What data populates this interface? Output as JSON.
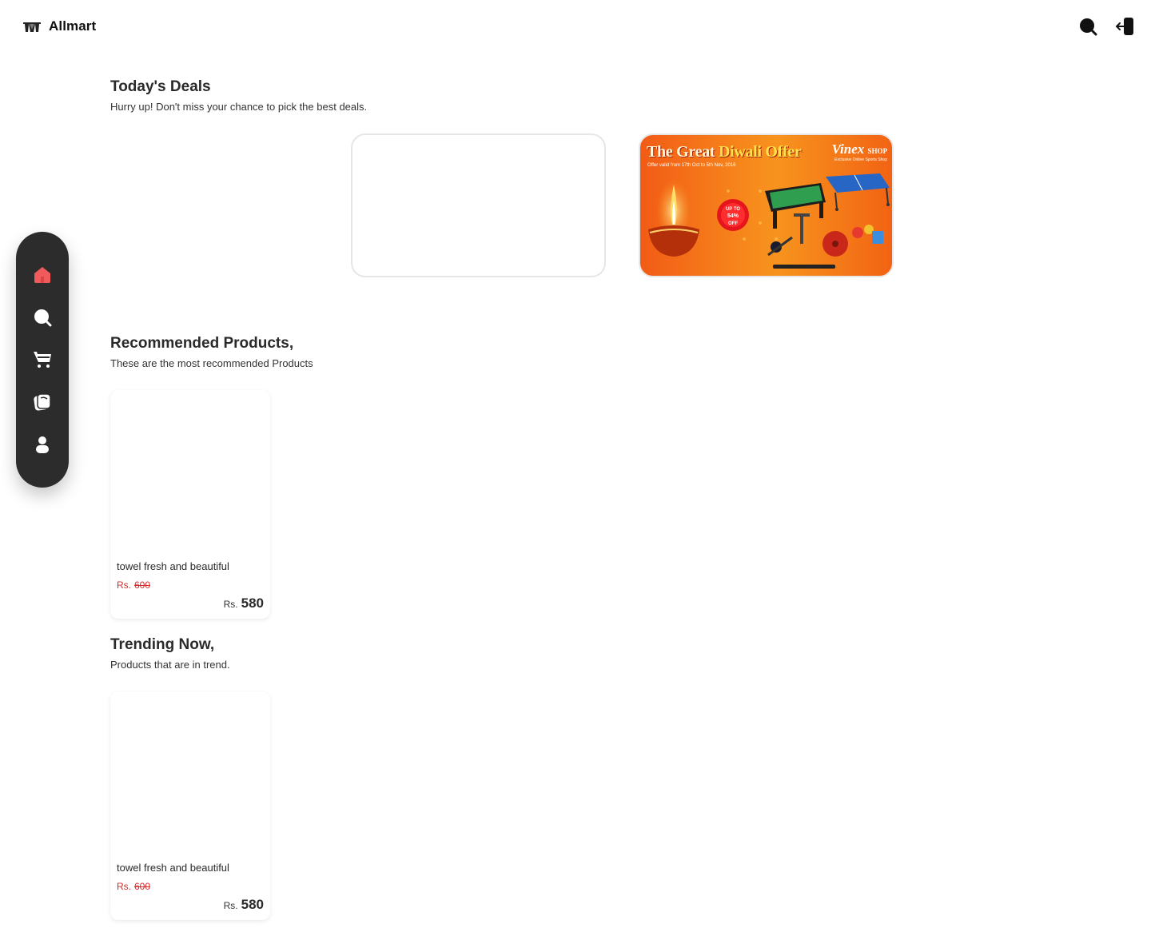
{
  "app": {
    "name": "Allmart"
  },
  "header": {
    "icons": [
      "search-icon",
      "logout-icon"
    ]
  },
  "sidebar": {
    "items": [
      {
        "name": "home",
        "icon": "home-icon",
        "active": true
      },
      {
        "name": "search",
        "icon": "search-icon",
        "active": false
      },
      {
        "name": "cart",
        "icon": "cart-icon",
        "active": false
      },
      {
        "name": "orders",
        "icon": "orders-icon",
        "active": false
      },
      {
        "name": "profile",
        "icon": "user-icon",
        "active": false
      }
    ]
  },
  "deals": {
    "title": "Today's Deals",
    "subtitle": "Hurry up! Don't miss your chance to pick the best deals.",
    "banner": {
      "title_part1": "The Great ",
      "title_part2": "Diwali Offer",
      "valid_text": "Offer valid from 17th Oct to 5th Nov, 2016",
      "brand": "Vinex",
      "brand_suffix": "SHOP",
      "brand_tagline": "Exclusive Online Sports Shop",
      "badge_line1": "UP TO",
      "badge_line2": "54%",
      "badge_line3": "OFF"
    }
  },
  "recommended": {
    "title": "Recommended Products,",
    "subtitle": "These are the most recommended Products",
    "products": [
      {
        "name": "towel fresh and beautiful",
        "currency": "Rs.",
        "old_price": "600",
        "price": "580"
      }
    ]
  },
  "trending": {
    "title": "Trending Now,",
    "subtitle": "Products that are in trend.",
    "products": [
      {
        "name": "towel fresh and beautiful",
        "currency": "Rs.",
        "old_price": "600",
        "price": "580"
      }
    ]
  },
  "colors": {
    "sidebar_bg": "#2c2c2c",
    "active_icon": "#f05a5a",
    "old_price": "#d92b2b"
  }
}
